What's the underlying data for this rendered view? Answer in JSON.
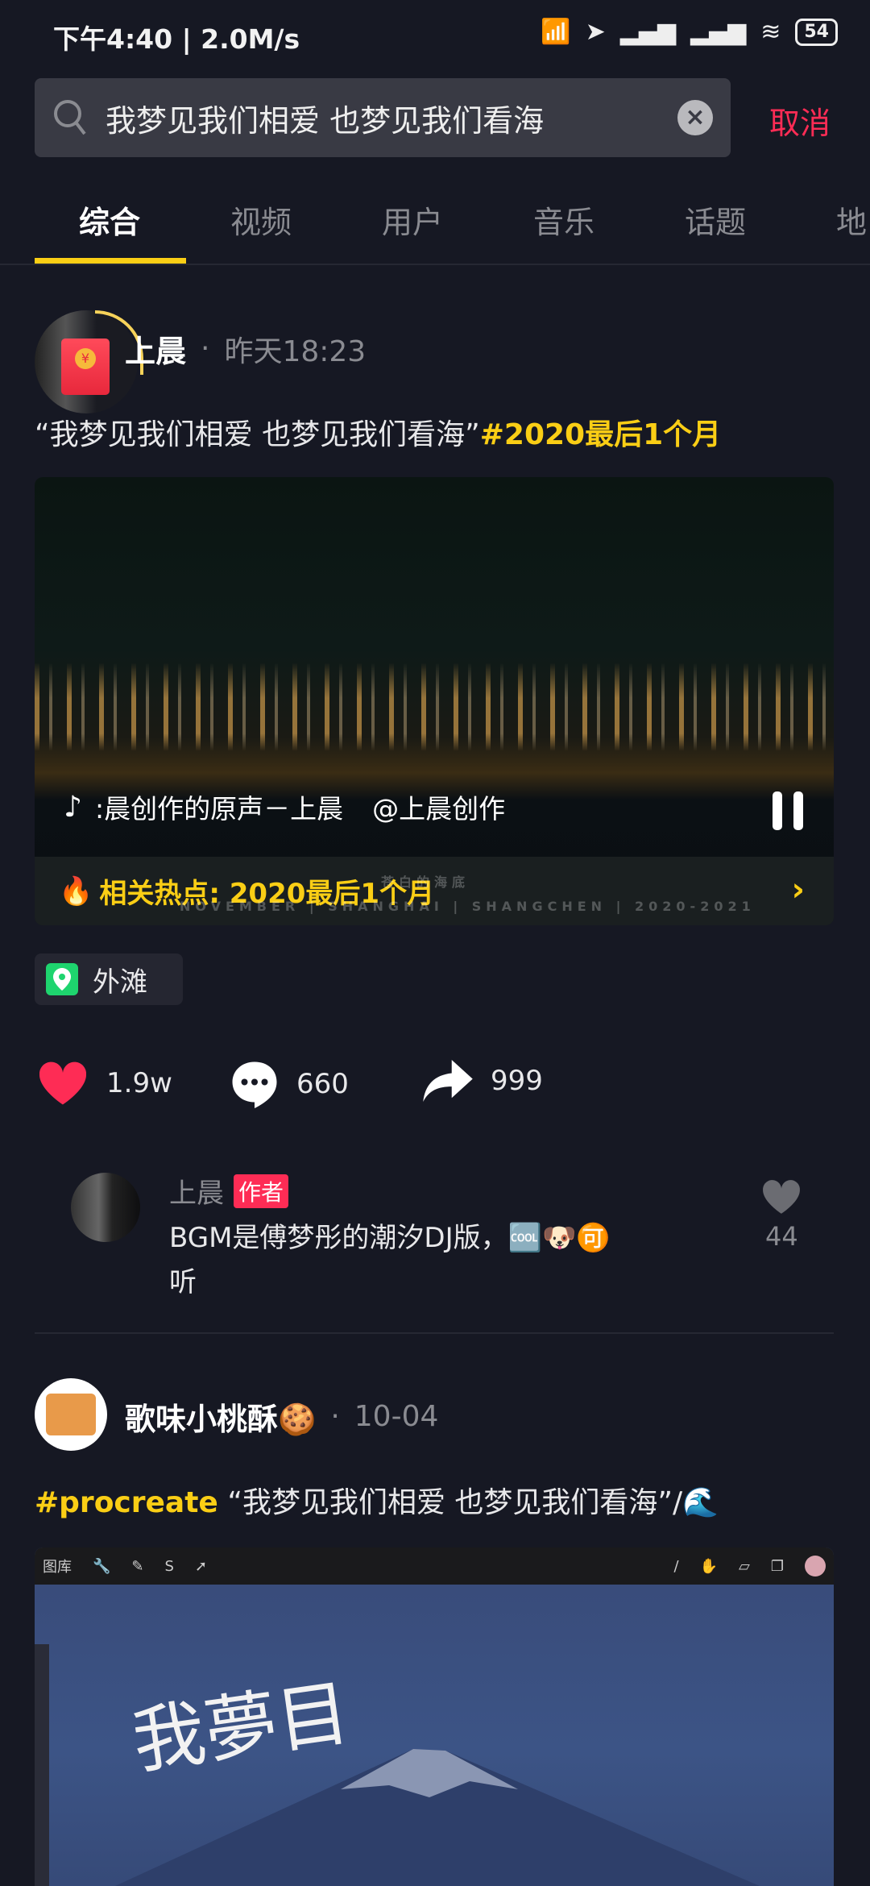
{
  "status_bar": {
    "time": "下午4:40",
    "speed": "2.0M/s",
    "battery": "54"
  },
  "search": {
    "value": "我梦见我们相爱 也梦见我们看海",
    "cancel": "取消"
  },
  "tabs": [
    "综合",
    "视频",
    "用户",
    "音乐",
    "话题",
    "地"
  ],
  "post1": {
    "author": "上晨",
    "time": "昨天18:23",
    "caption": "“我梦见我们相爱 也梦见我们看海”",
    "hashtag": "#2020最后1个月",
    "music": ":晨创作的原声－上晨",
    "music_author": "@上晨创作",
    "watermark_cn": "苍白的海底",
    "watermark_en": "NOVEMBER | SHANGHAI | SHANGCHEN | 2020-2021",
    "hot_topic": "相关热点: 2020最后1个月",
    "location": "外滩",
    "likes": "1.9w",
    "comments": "660",
    "shares": "999",
    "top_comment": {
      "author": "上晨",
      "badge": "作者",
      "text": "BGM是傅梦彤的潮汐DJ版，🆒🐶🉑",
      "text2": "听",
      "likes": "44"
    }
  },
  "post2": {
    "author": "歌味小桃酥🍪",
    "time": "10-04",
    "hashtag": "#procreate",
    "caption": "“我梦见我们相爱 也梦见我们看海”/🌊",
    "image_toolbar_label": "图库",
    "image_handwriting": "我夢目"
  },
  "colors": {
    "bg": "#161823",
    "accent_yellow": "#face15",
    "accent_red": "#fe2c55",
    "muted": "#8a8b91"
  }
}
